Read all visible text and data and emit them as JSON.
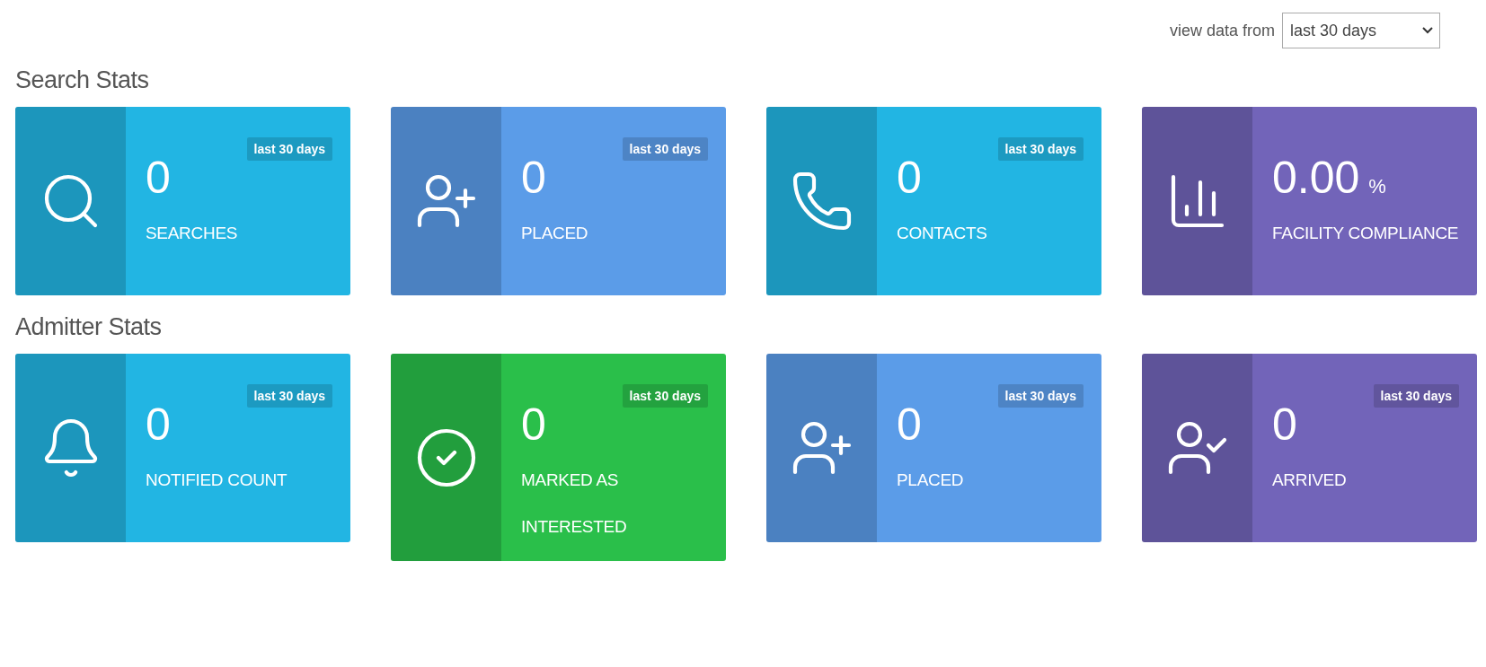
{
  "filter": {
    "label": "view data from",
    "value": "last 30 days"
  },
  "sections": [
    {
      "title": "Search Stats",
      "cards": [
        {
          "kind": "search",
          "color": "#22b5e3",
          "value": "0",
          "label": "SEARCHES",
          "badge": "last 30 days"
        },
        {
          "kind": "user-plus",
          "color": "#5b9ce8",
          "value": "0",
          "label": "PLACED",
          "badge": "last 30 days"
        },
        {
          "kind": "phone",
          "color": "#22b5e3",
          "value": "0",
          "label": "CONTACTS",
          "badge": "last 30 days"
        },
        {
          "kind": "chart",
          "color": "#7264b9",
          "value": "0.00",
          "unit": "%",
          "label": "FACILITY COMPLIANCE"
        }
      ]
    },
    {
      "title": "Admitter Stats",
      "cards": [
        {
          "kind": "bell",
          "color": "#22b5e3",
          "value": "0",
          "label": "NOTIFIED COUNT",
          "badge": "last 30 days"
        },
        {
          "kind": "check",
          "color": "#2abf4a",
          "value": "0",
          "label": "MARKED AS INTERESTED",
          "badge": "last 30 days"
        },
        {
          "kind": "user-plus",
          "color": "#5b9ce8",
          "value": "0",
          "label": "PLACED",
          "badge": "last 30 days"
        },
        {
          "kind": "user-check",
          "color": "#7264b9",
          "value": "0",
          "label": "ARRIVED",
          "badge": "last 30 days"
        }
      ]
    }
  ]
}
